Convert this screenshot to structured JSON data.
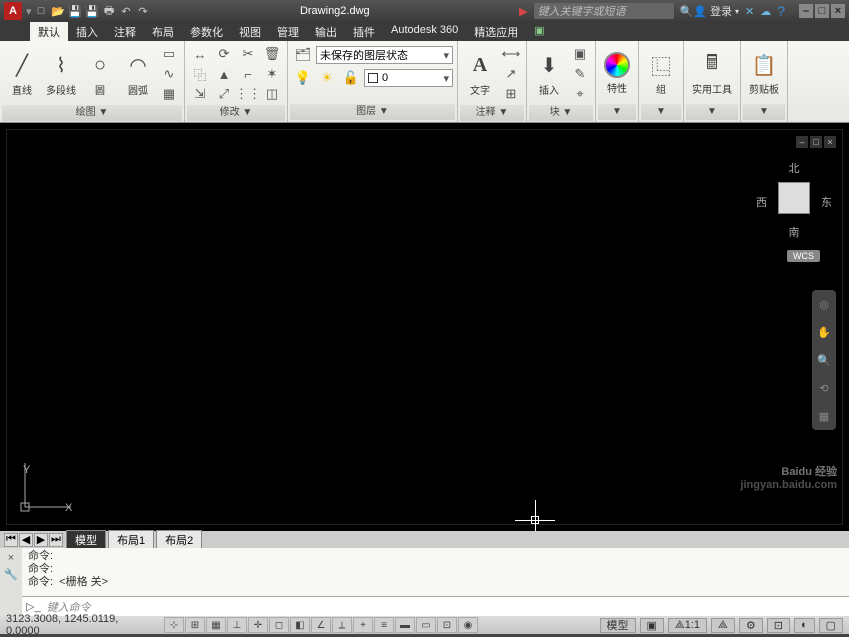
{
  "title": "Drawing2.dwg",
  "search_placeholder": "键入关键字或短语",
  "login": "登录",
  "menu": {
    "items": [
      "默认",
      "插入",
      "注释",
      "布局",
      "参数化",
      "视图",
      "管理",
      "输出",
      "插件",
      "Autodesk 360",
      "精选应用"
    ]
  },
  "ribbon": {
    "draw": {
      "title": "绘图 ▼",
      "line": "直线",
      "polyline": "多段线",
      "circle": "圆",
      "arc": "圆弧"
    },
    "modify": {
      "title": "修改 ▼"
    },
    "layer": {
      "title": "图层 ▼",
      "combo": "未保存的图层状态",
      "current": "0"
    },
    "annotate": {
      "title": "注释 ▼",
      "text": "文字"
    },
    "block": {
      "title": "块 ▼",
      "insert": "插入"
    },
    "props": {
      "title": "特性"
    },
    "group": {
      "title": "组"
    },
    "util": {
      "title": "实用工具"
    },
    "clip": {
      "title": "剪贴板"
    }
  },
  "viewcube": {
    "n": "北",
    "s": "南",
    "e": "东",
    "w": "西",
    "wcs": "WCS"
  },
  "ucs": {
    "x": "X",
    "y": "Y"
  },
  "model_tabs": {
    "model": "模型",
    "layout1": "布局1",
    "layout2": "布局2"
  },
  "cmd": {
    "label": "命令:",
    "grid": "<栅格 关>",
    "placeholder": "键入命令"
  },
  "status": {
    "coords": "3123.3008, 1245.0119, 0.0000",
    "model": "模型",
    "scale": "1:1"
  },
  "watermark": {
    "main": "Baidu 经验",
    "sub": "jingyan.baidu.com"
  }
}
